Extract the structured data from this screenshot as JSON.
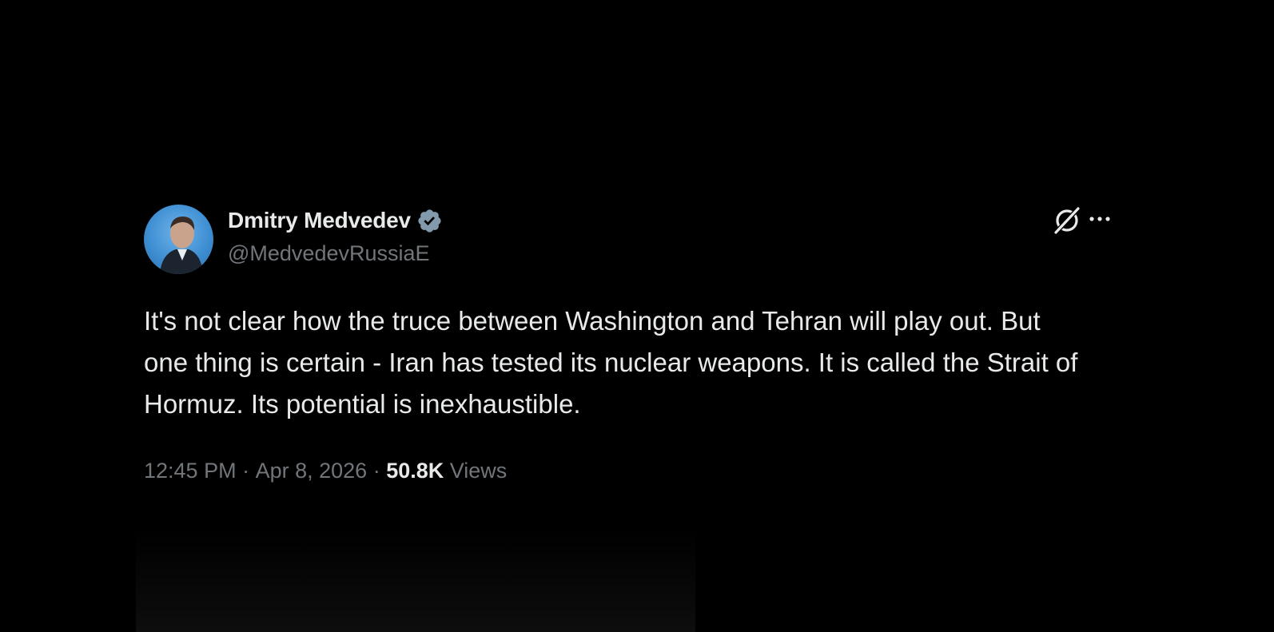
{
  "tweet": {
    "author": {
      "display_name": "Dmitry Medvedev",
      "handle": "@MedvedevRussiaE",
      "verified": true,
      "verified_color": "#829aab"
    },
    "icons": {
      "grok": "grok-icon",
      "more": "more-icon"
    },
    "text": "It's not clear how the truce between Washington and Tehran will play out. But one thing is certain - Iran has tested its nuclear weapons. It is called the Strait of Hormuz. Its potential is inexhaustible.",
    "meta": {
      "time": "12:45 PM",
      "separator": " · ",
      "date": "Apr 8, 2026",
      "views_count": "50.8K",
      "views_label": "Views"
    }
  },
  "colors": {
    "background": "#000000",
    "primary_text": "#e7e9ea",
    "secondary_text": "#71767b"
  }
}
